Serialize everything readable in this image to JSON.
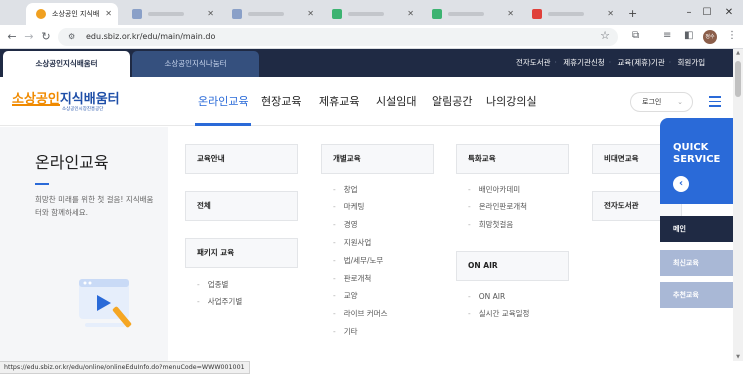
{
  "browser": {
    "active_tab_title": "소상공인 지식배",
    "url": "edu.sbiz.or.kr/edu/main/main.do",
    "status_url": "https://edu.sbiz.or.kr/edu/online/onlineEduInfo.do?menuCode=WWW001001",
    "profile_label": "정수"
  },
  "site": {
    "tabs": [
      "소상공인지식배움터",
      "소상공인지식나눔터"
    ],
    "util_links": [
      "전자도서관",
      "제휴기관신청",
      "교육(제휴)기관",
      "회원가입"
    ],
    "logo_main": "소상공인지식배움터",
    "logo_main_orange": "소상공인",
    "logo_main_blue": "지식배움터",
    "logo_sub": "소상공인시장진흥공단",
    "nav": [
      "온라인교육",
      "현장교육",
      "제휴교육",
      "시설임대",
      "알림공간",
      "나의강의실"
    ],
    "login_label": "로그인",
    "accent_color": "#2a6ad8"
  },
  "mega": {
    "title": "온라인교육",
    "desc": "희망찬 미래를 위한 첫 걸음! 지식배움터와 함께하세요.",
    "col1": {
      "cats": [
        "교육안내",
        "전체",
        "패키지 교육"
      ],
      "package_subs": [
        "업종별",
        "사업주기별"
      ]
    },
    "col2": {
      "cat": "개별교육",
      "subs": [
        "창업",
        "마케팅",
        "경영",
        "지원사업",
        "법/세무/노무",
        "판로개척",
        "교양",
        "라이브 커머스",
        "기타"
      ]
    },
    "col3": {
      "cat": "특화교육",
      "subs": [
        "배민아카데미",
        "온라인판로개척",
        "희망첫걸음"
      ],
      "cat2": "ON AIR",
      "subs2": [
        "ON AIR",
        "실시간 교육일정"
      ]
    },
    "col4": {
      "cats": [
        "비대면교육",
        "전자도서관"
      ]
    }
  },
  "quick": {
    "title_line1": "QUICK",
    "title_line2": "SERVICE",
    "items": [
      "메인",
      "최신교육",
      "추천교육"
    ]
  }
}
